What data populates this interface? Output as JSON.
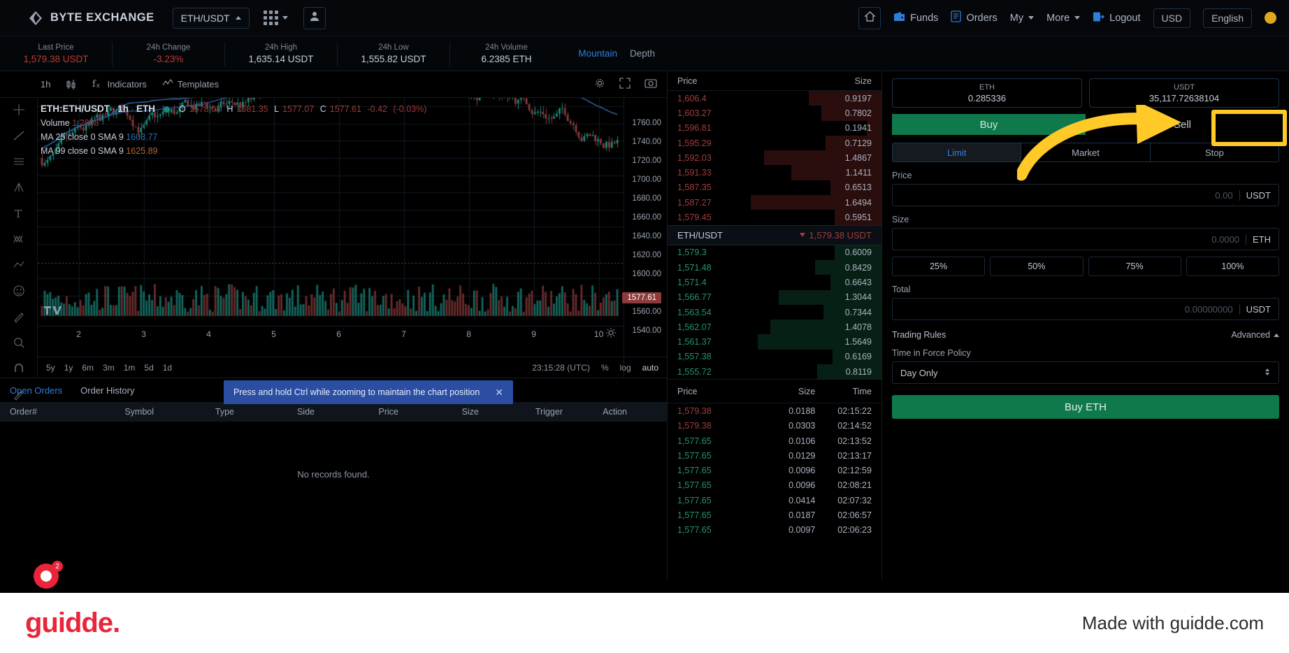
{
  "topnav": {
    "brand": "BYTE EXCHANGE",
    "brand_icon": "diamond-logo-icon",
    "pair": "ETH/USDT",
    "apps_icon": "grid-apps-icon",
    "avatar_icon": "user-avatar-icon",
    "home_icon": "home-icon",
    "links": [
      {
        "label": "Funds",
        "icon": "wallet-icon"
      },
      {
        "label": "Orders",
        "icon": "list-icon"
      },
      {
        "label": "My",
        "icon": "chevron-down-icon"
      },
      {
        "label": "More",
        "icon": "chevron-down-icon"
      },
      {
        "label": "Logout",
        "icon": "logout-icon"
      }
    ],
    "currency": "USD",
    "language": "English",
    "theme_icon": "sun-icon"
  },
  "stats": [
    {
      "label": "Last Price",
      "value": "1,579.38 USDT",
      "tone": "red"
    },
    {
      "label": "24h Change",
      "value": "-3.23%",
      "tone": "red"
    },
    {
      "label": "24h High",
      "value": "1,635.14 USDT",
      "tone": "normal"
    },
    {
      "label": "24h Low",
      "value": "1,555.82 USDT",
      "tone": "normal"
    },
    {
      "label": "24h Volume",
      "value": "6.2385 ETH",
      "tone": "normal"
    }
  ],
  "chart_mode": {
    "mountain": "Mountain",
    "depth": "Depth"
  },
  "chart_toolbar": {
    "interval": "1h",
    "candles_icon": "candlestick-icon",
    "indicators": "Indicators",
    "indicators_icon": "fx-icon",
    "templates": "Templates",
    "templates_icon": "chart-template-icon",
    "settings_icon": "gear-icon",
    "fullscreen_icon": "fullscreen-icon",
    "camera_icon": "camera-icon"
  },
  "chart_legend": {
    "symbol": "ETH:ETH/USDT",
    "interval": "1h",
    "asset": "ETH",
    "o_label": "O",
    "o": "1578.03",
    "h_label": "H",
    "h": "1581.35",
    "l_label": "L",
    "l": "1577.07",
    "c_label": "C",
    "c": "1577.61",
    "change": "-0.42",
    "change_pct": "(-0.03%)",
    "volume_label": "Volume",
    "volume_value": "1.2808",
    "ma25_label": "MA 25 close 0 SMA 9",
    "ma25_value": "1603.77",
    "ma99_label": "MA 99 close 0 SMA 9",
    "ma99_value": "1625.89"
  },
  "chart_data": {
    "type": "line",
    "title": "ETH:ETH/USDT 1h",
    "y_ticks": [
      "1760.00",
      "1740.00",
      "1720.00",
      "1700.00",
      "1680.00",
      "1660.00",
      "1640.00",
      "1620.00",
      "1600.00",
      "1560.00",
      "1540.00"
    ],
    "x_ticks": [
      "2",
      "3",
      "4",
      "5",
      "6",
      "7",
      "8",
      "9",
      "10"
    ],
    "current_price_tag": "1577.61",
    "ylim": [
      1530,
      1770
    ]
  },
  "chart_bottom": {
    "ranges": [
      "5y",
      "1y",
      "6m",
      "3m",
      "1m",
      "5d",
      "1d"
    ],
    "clock": "23:15:28 (UTC)",
    "percent": "%",
    "log": "log",
    "auto": "auto"
  },
  "chart_tooltip": {
    "text": "Press and hold Ctrl while zooming to maintain the chart position",
    "close_icon": "close-icon"
  },
  "orderbook": {
    "headers": {
      "price": "Price",
      "size": "Size"
    },
    "asks": [
      {
        "price": "1,606.4",
        "size": "0.9197",
        "depth": 34
      },
      {
        "price": "1,603.27",
        "size": "0.7802",
        "depth": 28
      },
      {
        "price": "1,596.81",
        "size": "0.1941",
        "depth": 7
      },
      {
        "price": "1,595.29",
        "size": "0.7129",
        "depth": 26
      },
      {
        "price": "1,592.03",
        "size": "1.4867",
        "depth": 55
      },
      {
        "price": "1,591.33",
        "size": "1.1411",
        "depth": 42
      },
      {
        "price": "1,587.35",
        "size": "0.6513",
        "depth": 24
      },
      {
        "price": "1,587.27",
        "size": "1.6494",
        "depth": 61
      },
      {
        "price": "1,579.45",
        "size": "0.5951",
        "depth": 22
      }
    ],
    "mid": {
      "pair": "ETH/USDT",
      "price": "1,579.38 USDT",
      "arrow": "arrow-down-icon"
    },
    "bids": [
      {
        "price": "1,579.3",
        "size": "0.6009",
        "depth": 22
      },
      {
        "price": "1,571.48",
        "size": "0.8429",
        "depth": 31
      },
      {
        "price": "1,571.4",
        "size": "0.6643",
        "depth": 24
      },
      {
        "price": "1,566.77",
        "size": "1.3044",
        "depth": 48
      },
      {
        "price": "1,563.54",
        "size": "0.7344",
        "depth": 27
      },
      {
        "price": "1,562.07",
        "size": "1.4078",
        "depth": 52
      },
      {
        "price": "1,561.37",
        "size": "1.5649",
        "depth": 58
      },
      {
        "price": "1,557.38",
        "size": "0.6169",
        "depth": 23
      },
      {
        "price": "1,555.72",
        "size": "0.8119",
        "depth": 30
      }
    ]
  },
  "trades": {
    "headers": {
      "price": "Price",
      "size": "Size",
      "time": "Time"
    },
    "rows": [
      {
        "price": "1,579.38",
        "size": "0.0188",
        "time": "02:15:22",
        "side": "sell"
      },
      {
        "price": "1,579.38",
        "size": "0.0303",
        "time": "02:14:52",
        "side": "sell"
      },
      {
        "price": "1,577.65",
        "size": "0.0106",
        "time": "02:13:52",
        "side": "buy"
      },
      {
        "price": "1,577.65",
        "size": "0.0129",
        "time": "02:13:17",
        "side": "buy"
      },
      {
        "price": "1,577.65",
        "size": "0.0096",
        "time": "02:12:59",
        "side": "buy"
      },
      {
        "price": "1,577.65",
        "size": "0.0096",
        "time": "02:08:21",
        "side": "buy"
      },
      {
        "price": "1,577.65",
        "size": "0.0414",
        "time": "02:07:32",
        "side": "buy"
      },
      {
        "price": "1,577.65",
        "size": "0.0187",
        "time": "02:06:57",
        "side": "buy"
      },
      {
        "price": "1,577.65",
        "size": "0.0097",
        "time": "02:06:23",
        "side": "buy"
      }
    ]
  },
  "orders_panel": {
    "tabs": [
      {
        "label": "Open Orders",
        "active": true
      },
      {
        "label": "Order History",
        "active": false
      }
    ],
    "columns": [
      "Order#",
      "Symbol",
      "Type",
      "Side",
      "Price",
      "Size",
      "Trigger",
      "Action"
    ],
    "empty": "No records found."
  },
  "trade_panel": {
    "balances": [
      {
        "asset": "ETH",
        "amount": "0.285336"
      },
      {
        "asset": "USDT",
        "amount": "35,117.72638104"
      }
    ],
    "buy": "Buy",
    "sell": "Sell",
    "order_types": [
      {
        "label": "Limit",
        "active": true
      },
      {
        "label": "Market",
        "active": false
      },
      {
        "label": "Stop",
        "active": false
      }
    ],
    "price_label": "Price",
    "price_placeholder": "0.00",
    "price_unit": "USDT",
    "size_label": "Size",
    "size_placeholder": "0.0000",
    "size_unit": "ETH",
    "percents": [
      "25%",
      "50%",
      "75%",
      "100%"
    ],
    "total_label": "Total",
    "total_placeholder": "0.00000000",
    "total_unit": "USDT",
    "trading_rules": "Trading Rules",
    "advanced": "Advanced",
    "advanced_icon": "chevron-up-icon",
    "tif_label": "Time in Force Policy",
    "tif_value": "Day Only",
    "submit": "Buy ETH"
  },
  "footer": {
    "logo": "guidde.",
    "made_with": "Made with guidde.com",
    "badge_count": "2"
  },
  "colors": {
    "accent_blue": "#2f7fd6",
    "buy_green": "#10794b",
    "sell_red": "#a33c3c",
    "highlight_yellow": "#ffc928",
    "brand_red": "#e8253a"
  }
}
